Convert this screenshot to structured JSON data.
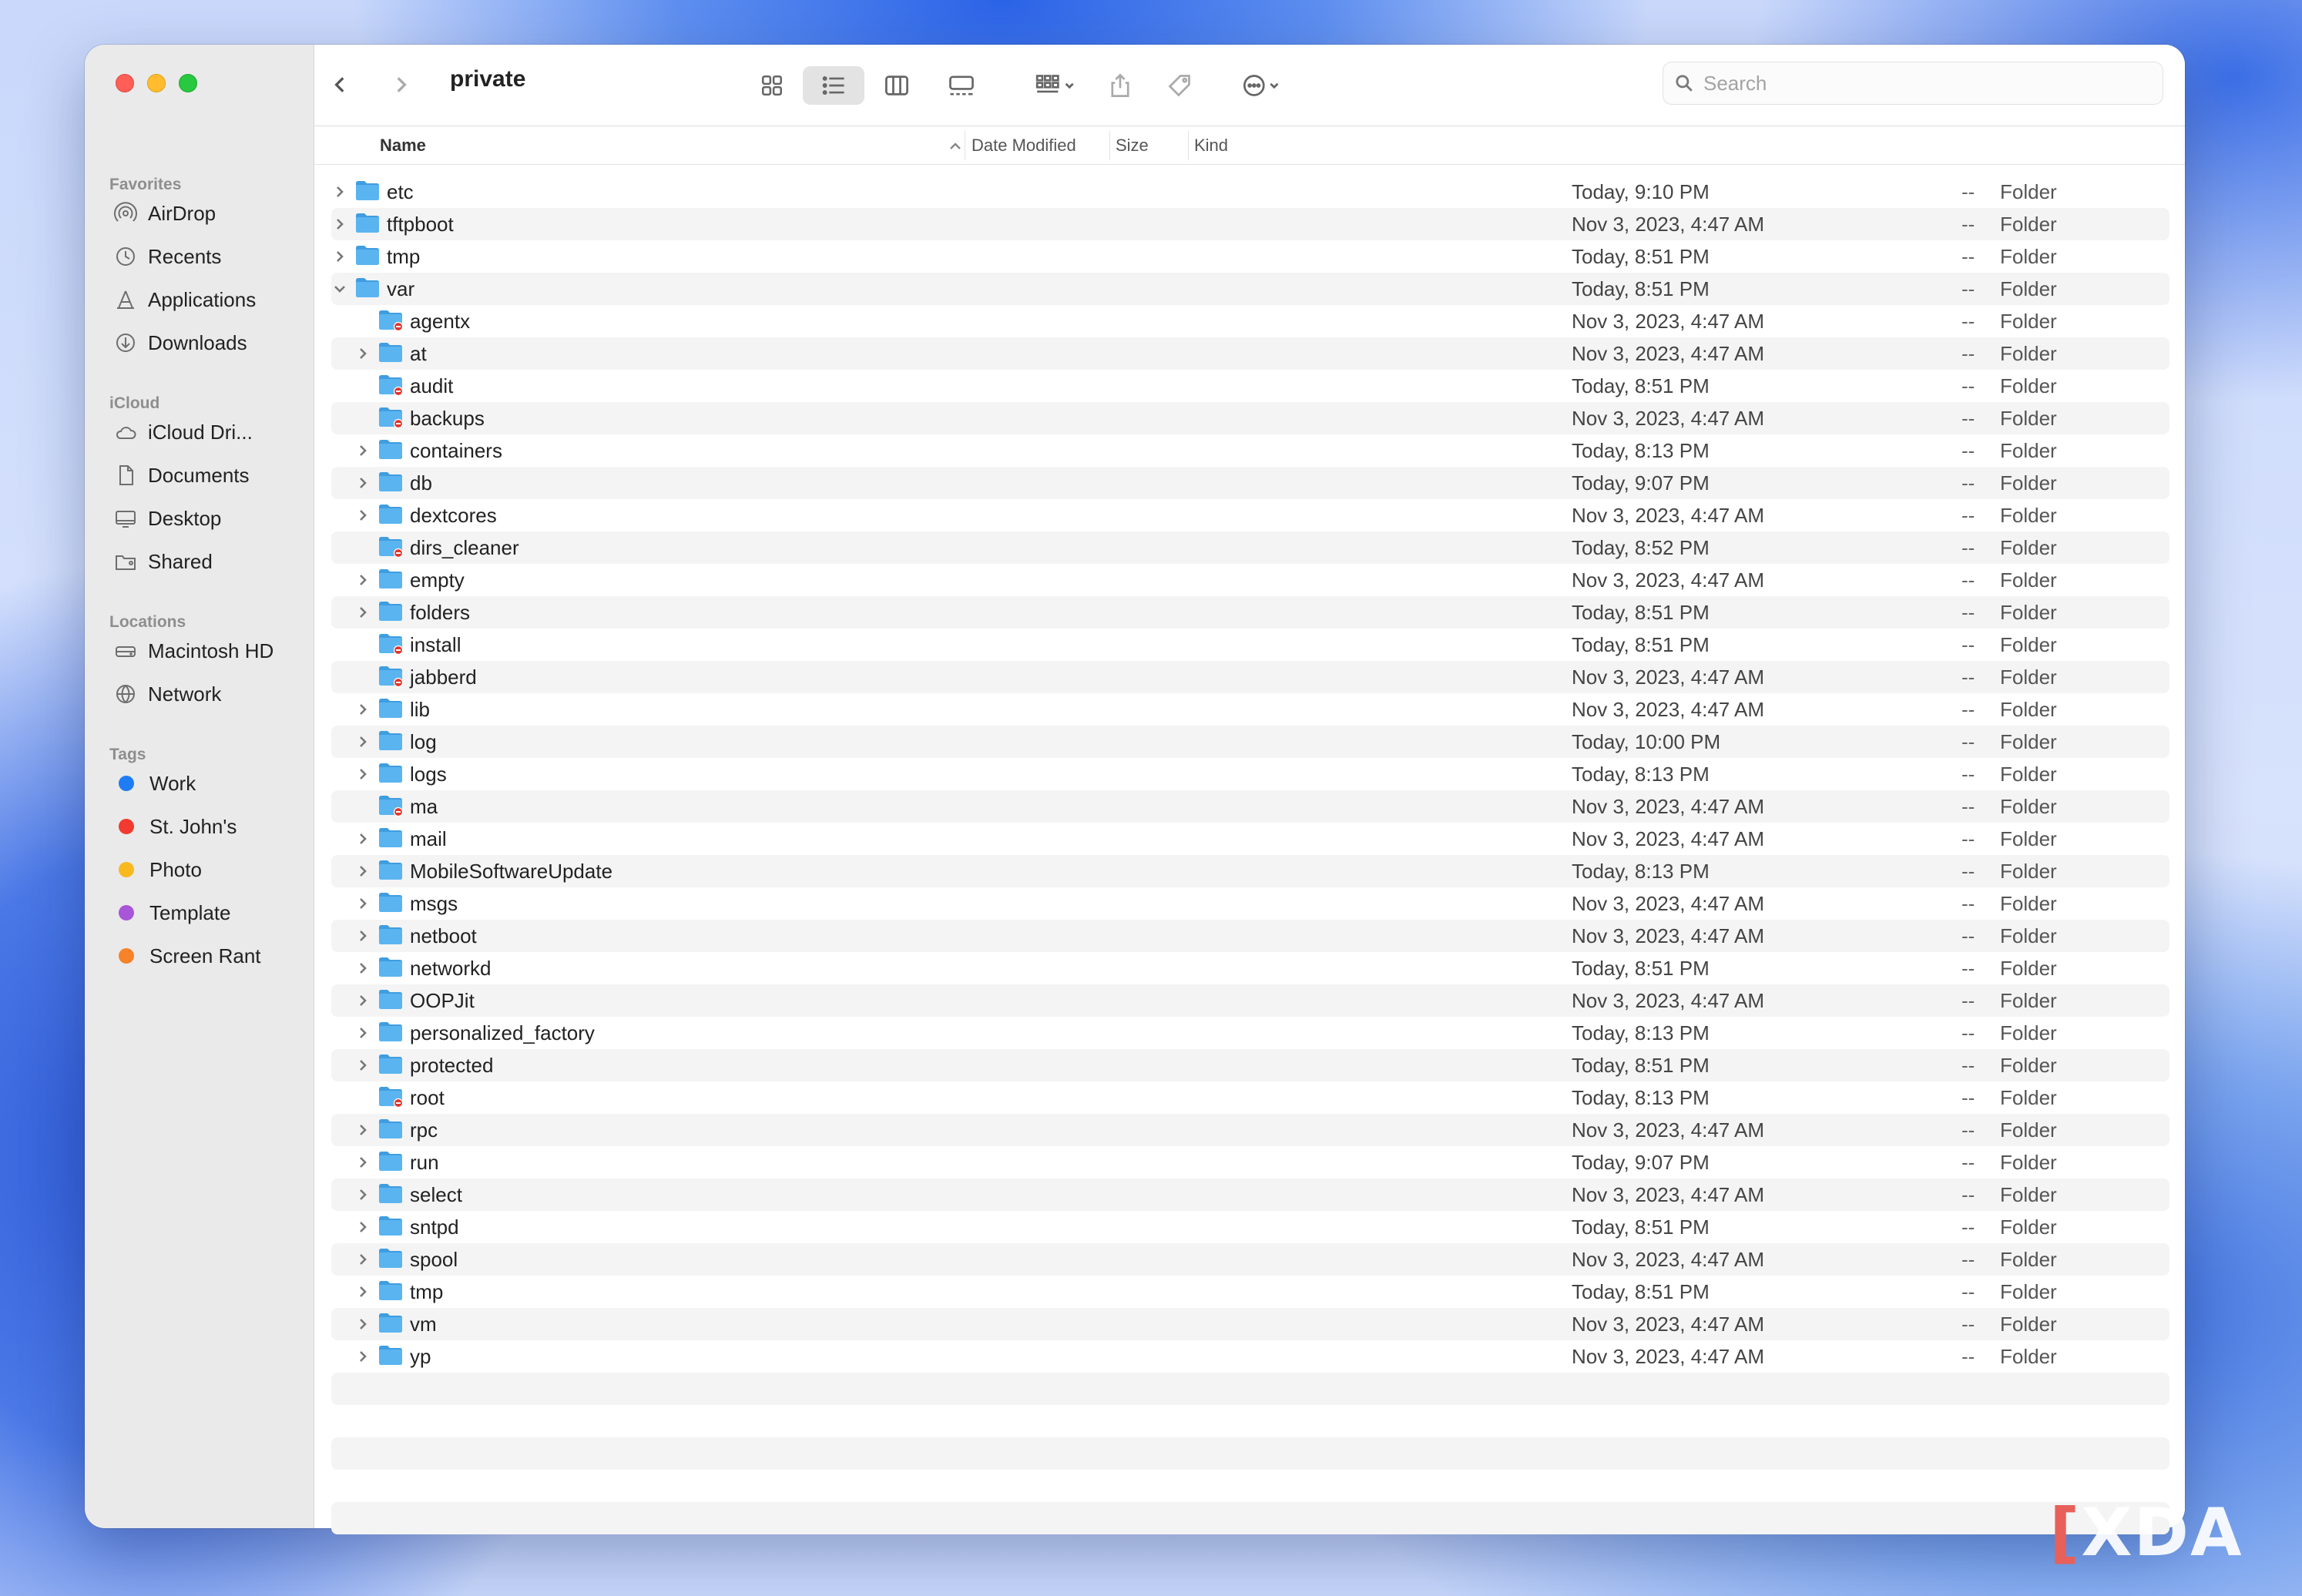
{
  "window": {
    "title": "private"
  },
  "sidebar": {
    "sections": [
      {
        "label": "Favorites",
        "items": [
          {
            "label": "AirDrop",
            "icon": "airdrop-icon"
          },
          {
            "label": "Recents",
            "icon": "clock-icon"
          },
          {
            "label": "Applications",
            "icon": "applications-icon"
          },
          {
            "label": "Downloads",
            "icon": "download-icon"
          }
        ]
      },
      {
        "label": "iCloud",
        "items": [
          {
            "label": "iCloud Dri...",
            "icon": "cloud-icon"
          },
          {
            "label": "Documents",
            "icon": "document-icon"
          },
          {
            "label": "Desktop",
            "icon": "desktop-icon"
          },
          {
            "label": "Shared",
            "icon": "shared-folder-icon"
          }
        ]
      },
      {
        "label": "Locations",
        "items": [
          {
            "label": "Macintosh HD",
            "icon": "harddrive-icon"
          },
          {
            "label": "Network",
            "icon": "globe-icon"
          }
        ]
      },
      {
        "label": "Tags",
        "items": [
          {
            "label": "Work",
            "color": "#1f7cf4"
          },
          {
            "label": "St. John's",
            "color": "#f23a30"
          },
          {
            "label": "Photo",
            "color": "#f8b91f"
          },
          {
            "label": "Template",
            "color": "#a855d8"
          },
          {
            "label": "Screen Rant",
            "color": "#f7822a"
          }
        ]
      }
    ]
  },
  "toolbar": {
    "search_placeholder": "Search"
  },
  "columns": {
    "name": "Name",
    "date": "Date Modified",
    "size": "Size",
    "kind": "Kind"
  },
  "rows": [
    {
      "name": "etc",
      "date": "Today, 9:10 PM",
      "size": "--",
      "kind": "Folder",
      "level": 0,
      "chevron": "right",
      "restricted": false
    },
    {
      "name": "tftpboot",
      "date": "Nov 3, 2023, 4:47 AM",
      "size": "--",
      "kind": "Folder",
      "level": 0,
      "chevron": "right",
      "restricted": false
    },
    {
      "name": "tmp",
      "date": "Today, 8:51 PM",
      "size": "--",
      "kind": "Folder",
      "level": 0,
      "chevron": "right",
      "restricted": false
    },
    {
      "name": "var",
      "date": "Today, 8:51 PM",
      "size": "--",
      "kind": "Folder",
      "level": 0,
      "chevron": "down",
      "restricted": false
    },
    {
      "name": "agentx",
      "date": "Nov 3, 2023, 4:47 AM",
      "size": "--",
      "kind": "Folder",
      "level": 1,
      "chevron": "none",
      "restricted": true
    },
    {
      "name": "at",
      "date": "Nov 3, 2023, 4:47 AM",
      "size": "--",
      "kind": "Folder",
      "level": 1,
      "chevron": "right",
      "restricted": false
    },
    {
      "name": "audit",
      "date": "Today, 8:51 PM",
      "size": "--",
      "kind": "Folder",
      "level": 1,
      "chevron": "none",
      "restricted": true
    },
    {
      "name": "backups",
      "date": "Nov 3, 2023, 4:47 AM",
      "size": "--",
      "kind": "Folder",
      "level": 1,
      "chevron": "none",
      "restricted": true
    },
    {
      "name": "containers",
      "date": "Today, 8:13 PM",
      "size": "--",
      "kind": "Folder",
      "level": 1,
      "chevron": "right",
      "restricted": false
    },
    {
      "name": "db",
      "date": "Today, 9:07 PM",
      "size": "--",
      "kind": "Folder",
      "level": 1,
      "chevron": "right",
      "restricted": false
    },
    {
      "name": "dextcores",
      "date": "Nov 3, 2023, 4:47 AM",
      "size": "--",
      "kind": "Folder",
      "level": 1,
      "chevron": "right",
      "restricted": false
    },
    {
      "name": "dirs_cleaner",
      "date": "Today, 8:52 PM",
      "size": "--",
      "kind": "Folder",
      "level": 1,
      "chevron": "none",
      "restricted": true
    },
    {
      "name": "empty",
      "date": "Nov 3, 2023, 4:47 AM",
      "size": "--",
      "kind": "Folder",
      "level": 1,
      "chevron": "right",
      "restricted": false
    },
    {
      "name": "folders",
      "date": "Today, 8:51 PM",
      "size": "--",
      "kind": "Folder",
      "level": 1,
      "chevron": "right",
      "restricted": false
    },
    {
      "name": "install",
      "date": "Today, 8:51 PM",
      "size": "--",
      "kind": "Folder",
      "level": 1,
      "chevron": "none",
      "restricted": true
    },
    {
      "name": "jabberd",
      "date": "Nov 3, 2023, 4:47 AM",
      "size": "--",
      "kind": "Folder",
      "level": 1,
      "chevron": "none",
      "restricted": true
    },
    {
      "name": "lib",
      "date": "Nov 3, 2023, 4:47 AM",
      "size": "--",
      "kind": "Folder",
      "level": 1,
      "chevron": "right",
      "restricted": false
    },
    {
      "name": "log",
      "date": "Today, 10:00 PM",
      "size": "--",
      "kind": "Folder",
      "level": 1,
      "chevron": "right",
      "restricted": false
    },
    {
      "name": "logs",
      "date": "Today, 8:13 PM",
      "size": "--",
      "kind": "Folder",
      "level": 1,
      "chevron": "right",
      "restricted": false
    },
    {
      "name": "ma",
      "date": "Nov 3, 2023, 4:47 AM",
      "size": "--",
      "kind": "Folder",
      "level": 1,
      "chevron": "none",
      "restricted": true
    },
    {
      "name": "mail",
      "date": "Nov 3, 2023, 4:47 AM",
      "size": "--",
      "kind": "Folder",
      "level": 1,
      "chevron": "right",
      "restricted": false
    },
    {
      "name": "MobileSoftwareUpdate",
      "date": "Today, 8:13 PM",
      "size": "--",
      "kind": "Folder",
      "level": 1,
      "chevron": "right",
      "restricted": false
    },
    {
      "name": "msgs",
      "date": "Nov 3, 2023, 4:47 AM",
      "size": "--",
      "kind": "Folder",
      "level": 1,
      "chevron": "right",
      "restricted": false
    },
    {
      "name": "netboot",
      "date": "Nov 3, 2023, 4:47 AM",
      "size": "--",
      "kind": "Folder",
      "level": 1,
      "chevron": "right",
      "restricted": false
    },
    {
      "name": "networkd",
      "date": "Today, 8:51 PM",
      "size": "--",
      "kind": "Folder",
      "level": 1,
      "chevron": "right",
      "restricted": false
    },
    {
      "name": "OOPJit",
      "date": "Nov 3, 2023, 4:47 AM",
      "size": "--",
      "kind": "Folder",
      "level": 1,
      "chevron": "right",
      "restricted": false
    },
    {
      "name": "personalized_factory",
      "date": "Today, 8:13 PM",
      "size": "--",
      "kind": "Folder",
      "level": 1,
      "chevron": "right",
      "restricted": false
    },
    {
      "name": "protected",
      "date": "Today, 8:51 PM",
      "size": "--",
      "kind": "Folder",
      "level": 1,
      "chevron": "right",
      "restricted": false
    },
    {
      "name": "root",
      "date": "Today, 8:13 PM",
      "size": "--",
      "kind": "Folder",
      "level": 1,
      "chevron": "none",
      "restricted": true
    },
    {
      "name": "rpc",
      "date": "Nov 3, 2023, 4:47 AM",
      "size": "--",
      "kind": "Folder",
      "level": 1,
      "chevron": "right",
      "restricted": false
    },
    {
      "name": "run",
      "date": "Today, 9:07 PM",
      "size": "--",
      "kind": "Folder",
      "level": 1,
      "chevron": "right",
      "restricted": false
    },
    {
      "name": "select",
      "date": "Nov 3, 2023, 4:47 AM",
      "size": "--",
      "kind": "Folder",
      "level": 1,
      "chevron": "right",
      "restricted": false
    },
    {
      "name": "sntpd",
      "date": "Today, 8:51 PM",
      "size": "--",
      "kind": "Folder",
      "level": 1,
      "chevron": "right",
      "restricted": false
    },
    {
      "name": "spool",
      "date": "Nov 3, 2023, 4:47 AM",
      "size": "--",
      "kind": "Folder",
      "level": 1,
      "chevron": "right",
      "restricted": false
    },
    {
      "name": "tmp",
      "date": "Today, 8:51 PM",
      "size": "--",
      "kind": "Folder",
      "level": 1,
      "chevron": "right",
      "restricted": false
    },
    {
      "name": "vm",
      "date": "Nov 3, 2023, 4:47 AM",
      "size": "--",
      "kind": "Folder",
      "level": 1,
      "chevron": "right",
      "restricted": false
    },
    {
      "name": "yp",
      "date": "Nov 3, 2023, 4:47 AM",
      "size": "--",
      "kind": "Folder",
      "level": 1,
      "chevron": "right",
      "restricted": false
    }
  ],
  "colors": {
    "folder": "#5ab4f0",
    "folder_dark": "#3f9de0",
    "restricted_badge": "#e2352c"
  },
  "watermark": "XDA"
}
